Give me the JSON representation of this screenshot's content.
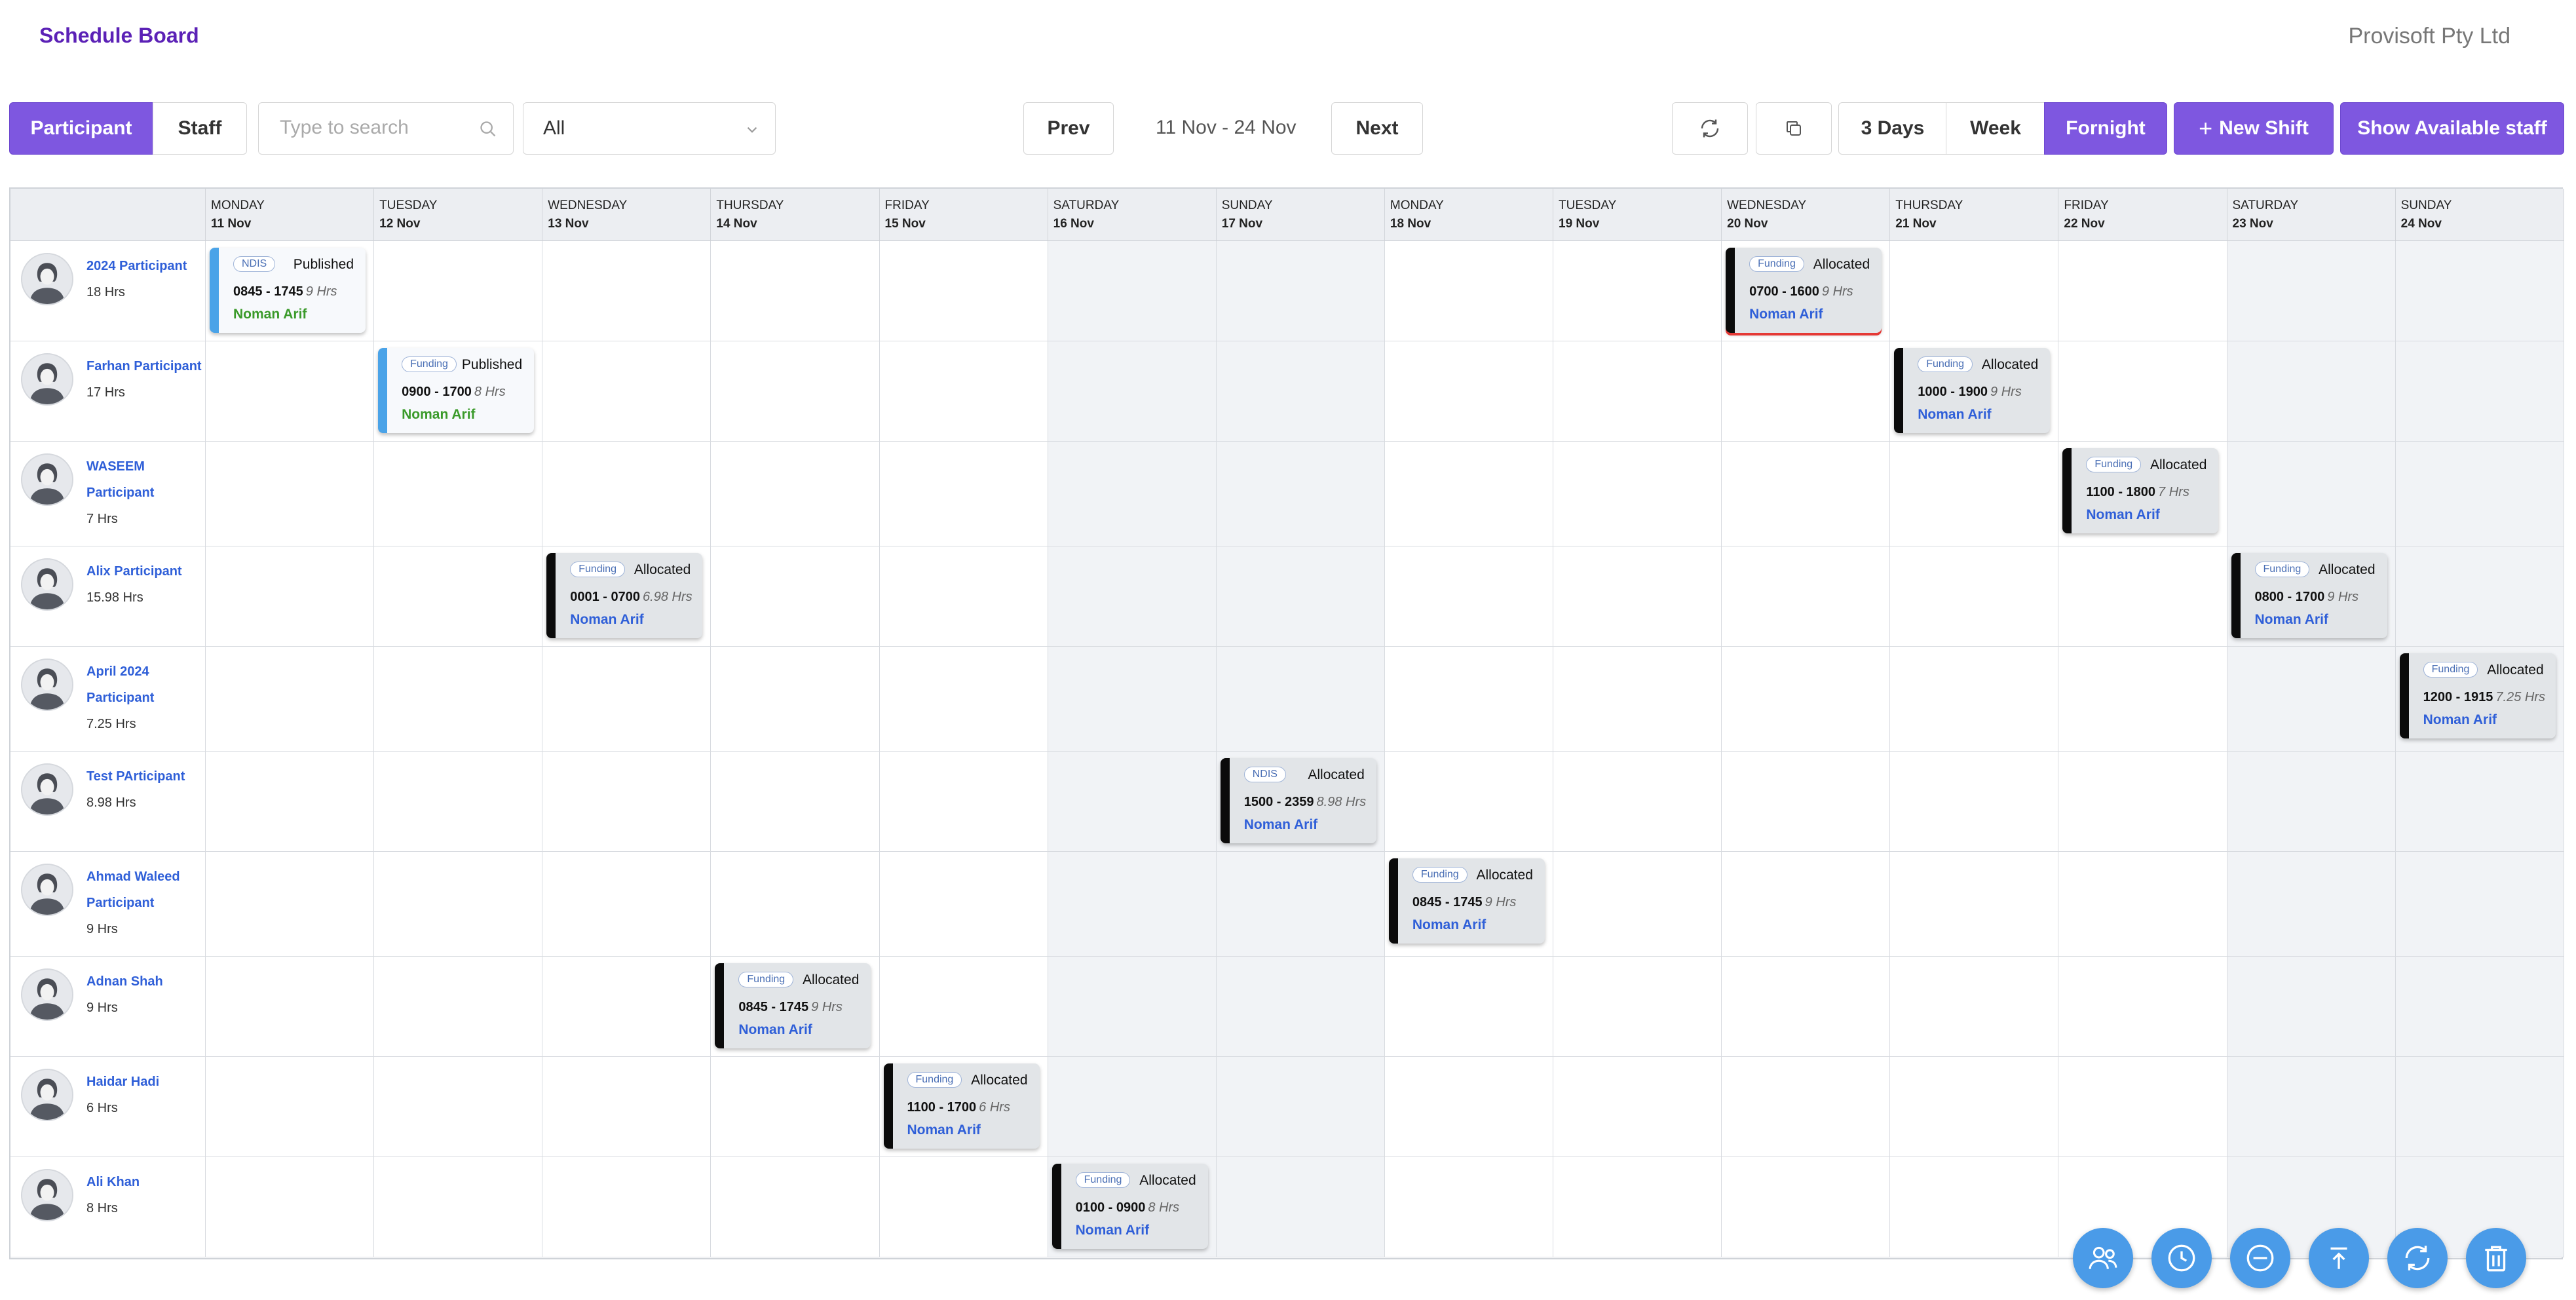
{
  "header": {
    "title": "Schedule Board",
    "company": "Provisoft Pty Ltd"
  },
  "toolbar": {
    "participant": "Participant",
    "staff": "Staff",
    "search_placeholder": "Type to search",
    "filter_value": "All",
    "prev": "Prev",
    "range": "11 Nov - 24 Nov",
    "next": "Next",
    "three_days": "3 Days",
    "week": "Week",
    "fortnight": "Fornight",
    "new_shift": "New Shift",
    "show_available": "Show Available staff"
  },
  "days": [
    {
      "dow": "MONDAY",
      "date": "11 Nov"
    },
    {
      "dow": "TUESDAY",
      "date": "12 Nov"
    },
    {
      "dow": "WEDNESDAY",
      "date": "13 Nov"
    },
    {
      "dow": "THURSDAY",
      "date": "14 Nov"
    },
    {
      "dow": "FRIDAY",
      "date": "15 Nov"
    },
    {
      "dow": "SATURDAY",
      "date": "16 Nov"
    },
    {
      "dow": "SUNDAY",
      "date": "17 Nov"
    },
    {
      "dow": "MONDAY",
      "date": "18 Nov"
    },
    {
      "dow": "TUESDAY",
      "date": "19 Nov"
    },
    {
      "dow": "WEDNESDAY",
      "date": "20 Nov"
    },
    {
      "dow": "THURSDAY",
      "date": "21 Nov"
    },
    {
      "dow": "FRIDAY",
      "date": "22 Nov"
    },
    {
      "dow": "SATURDAY",
      "date": "23 Nov"
    },
    {
      "dow": "SUNDAY",
      "date": "24 Nov"
    }
  ],
  "participants": [
    {
      "name": "2024 Participant",
      "hours": "18 Hrs",
      "shifts": [
        {
          "day": 0,
          "funding": "NDIS",
          "status": "Published",
          "time": "0845 - 1745",
          "duration": "9 Hrs",
          "staff": "Noman Arif",
          "kind": "pub"
        },
        {
          "day": 9,
          "funding": "Funding",
          "status": "Allocated",
          "time": "0700 - 1600",
          "duration": "9 Hrs",
          "staff": "Noman Arif",
          "kind": "alloc",
          "warn": true
        }
      ]
    },
    {
      "name": "Farhan Participant",
      "hours": "17 Hrs",
      "shifts": [
        {
          "day": 1,
          "funding": "Funding",
          "status": "Published",
          "time": "0900 - 1700",
          "duration": "8 Hrs",
          "staff": "Noman Arif",
          "kind": "pub"
        },
        {
          "day": 10,
          "funding": "Funding",
          "status": "Allocated",
          "time": "1000 - 1900",
          "duration": "9 Hrs",
          "staff": "Noman Arif",
          "kind": "alloc"
        }
      ]
    },
    {
      "name": "WASEEM Participant",
      "hours": "7 Hrs",
      "shifts": [
        {
          "day": 11,
          "funding": "Funding",
          "status": "Allocated",
          "time": "1100 - 1800",
          "duration": "7 Hrs",
          "staff": "Noman Arif",
          "kind": "alloc"
        }
      ]
    },
    {
      "name": "Alix Participant",
      "hours": "15.98 Hrs",
      "shifts": [
        {
          "day": 2,
          "funding": "Funding",
          "status": "Allocated",
          "time": "0001 - 0700",
          "duration": "6.98 Hrs",
          "staff": "Noman Arif",
          "kind": "alloc"
        },
        {
          "day": 12,
          "funding": "Funding",
          "status": "Allocated",
          "time": "0800 - 1700",
          "duration": "9 Hrs",
          "staff": "Noman Arif",
          "kind": "alloc"
        }
      ]
    },
    {
      "name": "April 2024 Participant",
      "hours": "7.25 Hrs",
      "shifts": [
        {
          "day": 13,
          "funding": "Funding",
          "status": "Allocated",
          "time": "1200 - 1915",
          "duration": "7.25 Hrs",
          "staff": "Noman Arif",
          "kind": "alloc"
        }
      ]
    },
    {
      "name": "Test PArticipant",
      "hours": "8.98 Hrs",
      "shifts": [
        {
          "day": 6,
          "funding": "NDIS",
          "status": "Allocated",
          "time": "1500 - 2359",
          "duration": "8.98 Hrs",
          "staff": "Noman Arif",
          "kind": "alloc"
        }
      ]
    },
    {
      "name": "Ahmad Waleed Participant",
      "hours": "9 Hrs",
      "shifts": [
        {
          "day": 7,
          "funding": "Funding",
          "status": "Allocated",
          "time": "0845 - 1745",
          "duration": "9 Hrs",
          "staff": "Noman Arif",
          "kind": "alloc"
        }
      ]
    },
    {
      "name": "Adnan Shah",
      "hours": "9 Hrs",
      "shifts": [
        {
          "day": 3,
          "funding": "Funding",
          "status": "Allocated",
          "time": "0845 - 1745",
          "duration": "9 Hrs",
          "staff": "Noman Arif",
          "kind": "alloc"
        }
      ]
    },
    {
      "name": "Haidar Hadi",
      "hours": "6 Hrs",
      "shifts": [
        {
          "day": 4,
          "funding": "Funding",
          "status": "Allocated",
          "time": "1100 - 1700",
          "duration": "6 Hrs",
          "staff": "Noman Arif",
          "kind": "alloc"
        }
      ]
    },
    {
      "name": "Ali Khan",
      "hours": "8 Hrs",
      "shifts": [
        {
          "day": 5,
          "funding": "Funding",
          "status": "Allocated",
          "time": "0100 - 0900",
          "duration": "8 Hrs",
          "staff": "Noman Arif",
          "kind": "alloc"
        }
      ]
    }
  ],
  "fab_icons": [
    "users-icon",
    "clock-icon",
    "minus-circle-icon",
    "upload-top-icon",
    "refresh-icon",
    "trash-icon"
  ],
  "colors": {
    "accent": "#7e57e0",
    "published": "#4aa3e8",
    "allocated": "#0b0b0b",
    "warning": "#e53935",
    "fab": "#4a9be8",
    "link": "#2f5fd8",
    "staff_published": "#3a9a2a"
  }
}
